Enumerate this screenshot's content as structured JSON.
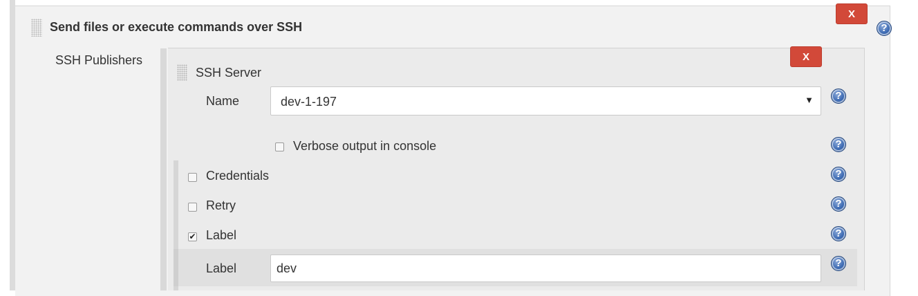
{
  "section": {
    "title": "Send files or execute commands over SSH",
    "delete_label": "X"
  },
  "publishers": {
    "label": "SSH Publishers"
  },
  "ssh_server": {
    "title": "SSH Server",
    "delete_label": "X",
    "name_label": "Name",
    "name_value": "dev-1-197",
    "dropdown_arrow": "▼",
    "verbose_label": "Verbose output in console",
    "verbose_checked": false,
    "credentials_label": "Credentials",
    "credentials_checked": false,
    "retry_label": "Retry",
    "retry_checked": false,
    "label_checkbox_label": "Label",
    "label_checkbox_checked": true,
    "label_checkmark": "✔",
    "label_field_label": "Label",
    "label_field_value": "dev"
  },
  "help_icon": {
    "glyph": "?",
    "color": "#3d6bb3"
  },
  "colors": {
    "delete_button": "#d24939",
    "panel_bg": "#f2f2f2",
    "inner_panel_bg": "#ebebeb"
  },
  "icons": [
    "drag-handle-icon",
    "help-icon",
    "chevron-down-icon",
    "checkmark-icon"
  ]
}
